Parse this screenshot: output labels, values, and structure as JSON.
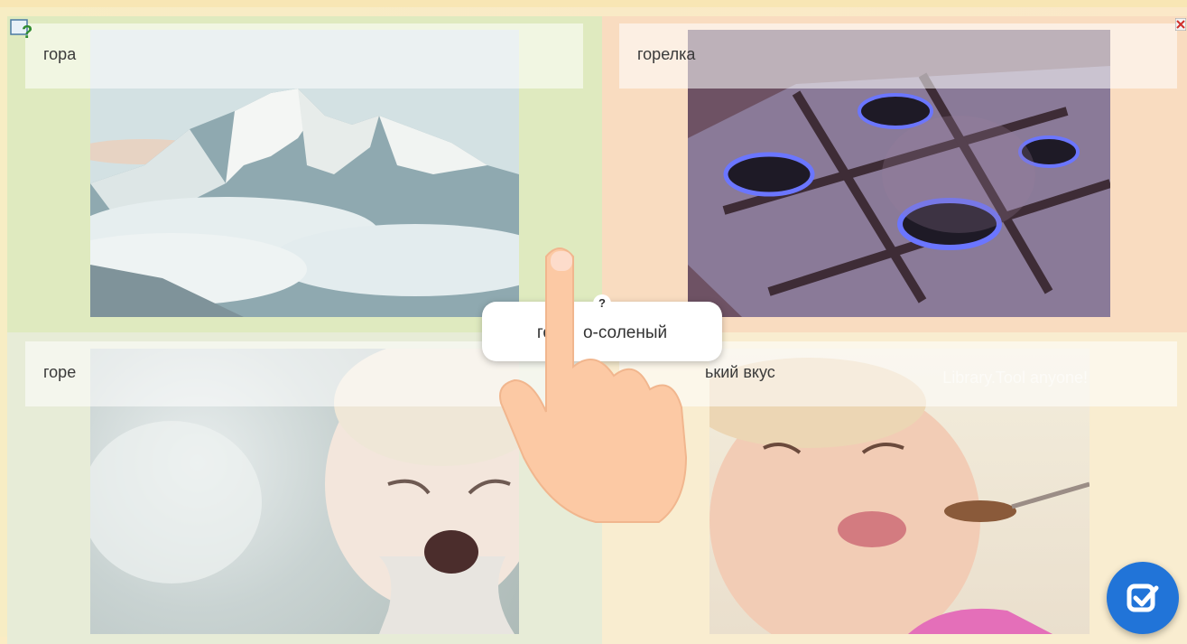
{
  "cards": [
    {
      "id": "mountain",
      "label": "гора",
      "image_icon": "mountain-photo"
    },
    {
      "id": "burner",
      "label": "горелка",
      "image_icon": "gas-burner-photo"
    },
    {
      "id": "grief",
      "label": "горе",
      "image_icon": "crying-child-photo"
    },
    {
      "id": "bitter",
      "label": "горький вкус",
      "visible_label": "ький вкус",
      "image_icon": "bitter-taste-photo"
    }
  ],
  "draggable_word": {
    "text": "горько-соленый",
    "visible_left": "го",
    "visible_right": "о-соленый",
    "help_mark": "?"
  },
  "watermark": "Library.Tool anyone!",
  "colors": {
    "accent": "#2174d8",
    "check_icon": "#ffffff",
    "hand": "#fcc9a4",
    "help_icon": "#2e8b2e"
  },
  "icons": {
    "help": "help-question-icon",
    "close": "close-icon",
    "check": "check-icon",
    "hand": "hand-pointer-icon"
  }
}
